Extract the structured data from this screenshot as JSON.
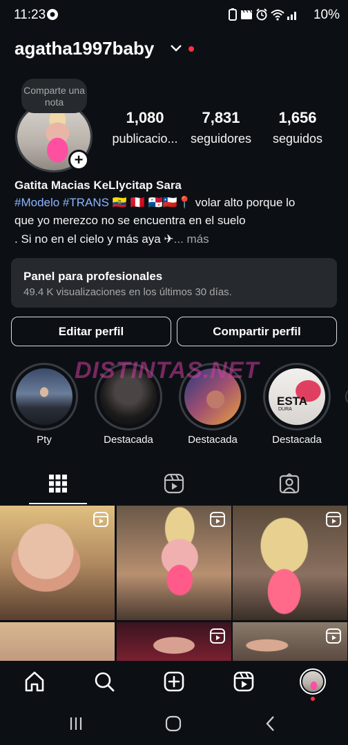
{
  "status": {
    "time": "11:23",
    "battery": "10%"
  },
  "profile": {
    "username": "agatha1997baby",
    "note_bubble": "Comparte una nota"
  },
  "stats": [
    {
      "value": "1,080",
      "label": "publicacio..."
    },
    {
      "value": "7,831",
      "label": "seguidores"
    },
    {
      "value": "1,656",
      "label": "seguidos"
    }
  ],
  "bio": {
    "name": "Gatita Macias KeLlycitap Sara",
    "tags": "#Modelo #TRANS",
    "flags": "🇪🇨 🇵🇪 🇵🇦🇨🇱📍",
    "line1_rest": "volar alto porque  lo",
    "line2": "que yo merezco no se encuentra en el suelo",
    "line3": ". Si no en el cielo y más  aya ✈",
    "more": "... más"
  },
  "pro_panel": {
    "title": "Panel para profesionales",
    "subtitle": "49.4 K visualizaciones en los últimos 30 días."
  },
  "buttons": {
    "edit": "Editar perfil",
    "share": "Compartir perfil"
  },
  "watermark": "DISTINTAS.NET",
  "highlights": [
    {
      "label": "Pty"
    },
    {
      "label": "Destacada"
    },
    {
      "label": "Destacada"
    },
    {
      "label": "Destacada",
      "cover_text": "ESTA",
      "cover_sub": "DURA"
    }
  ],
  "tabs": [
    "grid-icon",
    "reels-icon",
    "tagged-icon"
  ],
  "nav": [
    "home-icon",
    "search-icon",
    "create-icon",
    "reels-icon",
    "profile-avatar"
  ],
  "colors": {
    "background": "#0c1014",
    "panel": "#262a2e",
    "link": "#8fb4ff",
    "notification": "#ff3040"
  }
}
